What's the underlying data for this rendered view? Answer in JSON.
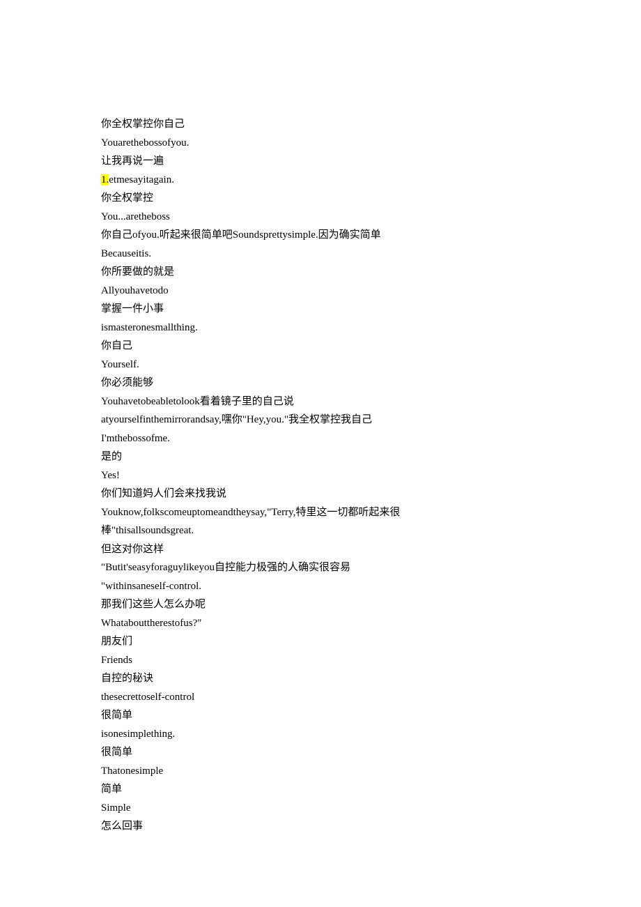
{
  "lines": [
    {
      "text": "你全权掌控你自己"
    },
    {
      "text": "Youarethebossofyou."
    },
    {
      "text": "让我再说一遍"
    },
    {
      "highlight": "1.",
      "rest": "etmesayitagain."
    },
    {
      "text": "你全权掌控"
    },
    {
      "text": "You...aretheboss"
    },
    {
      "text": "你自己ofyou.听起来很简单吧Soundsprettysimple.因为确实简单"
    },
    {
      "text": "Becauseitis."
    },
    {
      "text": "你所要做的就是"
    },
    {
      "text": "Allyouhavetodo"
    },
    {
      "text": "掌握一件小事"
    },
    {
      "text": "ismasteronesmallthing."
    },
    {
      "text": "你自己"
    },
    {
      "text": "Yourself."
    },
    {
      "text": "你必须能够"
    },
    {
      "text": "Youhavetobeabletolook看着镜子里的自己说"
    },
    {
      "text": "atyourselfinthemirrorandsay,嘿你\"Hey,you.\"我全权掌控我自己"
    },
    {
      "text": "I'mthebossofme."
    },
    {
      "text": "是的"
    },
    {
      "text": "Yes!"
    },
    {
      "text": "你们知道妈人们会来找我说"
    },
    {
      "text": "Youknow,folkscomeuptomeandtheysay,\"Terry,特里这一切都听起来很"
    },
    {
      "text": "棒\"thisallsoundsgreat."
    },
    {
      "text": "但这对你这样"
    },
    {
      "text": "\"Butit'seasyforaguylikeyou自控能力极强的人确实很容易"
    },
    {
      "text": "\"withinsaneself-control."
    },
    {
      "text": "那我们这些人怎么办呢"
    },
    {
      "text": "Whatabouttherestofus?\""
    },
    {
      "text": "朋友们"
    },
    {
      "text": "Friends"
    },
    {
      "text": "自控的秘诀"
    },
    {
      "text": "thesecrettoself-control"
    },
    {
      "text": "很简单"
    },
    {
      "text": "isonesimplething."
    },
    {
      "text": "很简单"
    },
    {
      "text": "Thatonesimple"
    },
    {
      "text": "简单"
    },
    {
      "text": "Simple"
    },
    {
      "text": "怎么回事"
    }
  ]
}
